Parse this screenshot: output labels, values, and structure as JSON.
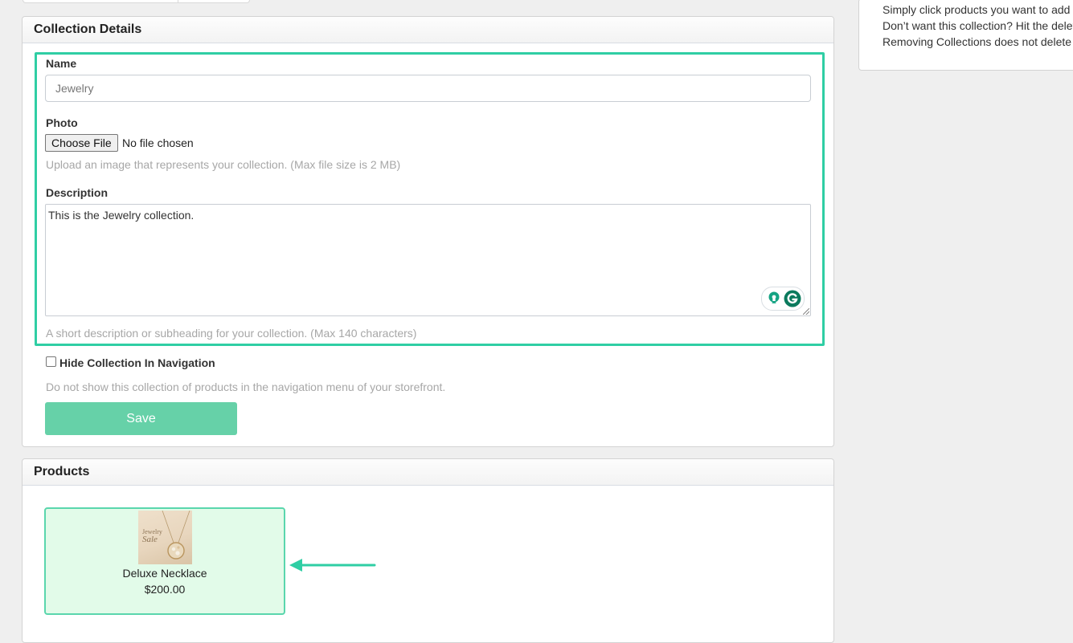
{
  "help_panel": {
    "lines": [
      "Simply click products you want to add",
      "Don’t want this collection? Hit the delete",
      "Removing Collections does not delete"
    ]
  },
  "collection_details": {
    "title": "Collection Details",
    "name_label": "Name",
    "name_value": "Jewelry",
    "photo_label": "Photo",
    "choose_file_label": "Choose File",
    "file_status": "No file chosen",
    "photo_help": "Upload an image that represents your collection. (Max file size is 2 MB)",
    "description_label": "Description",
    "description_value": "This is the Jewelry collection.",
    "description_help": "A short description or subheading for your collection. (Max 140 characters)",
    "hide_label": "Hide Collection In Navigation",
    "hide_checked": false,
    "hide_help": "Do not show this collection of products in the navigation menu of your storefront.",
    "save_label": "Save"
  },
  "products": {
    "title": "Products",
    "items": [
      {
        "name": "Deluxe Necklace",
        "price": "$200.00",
        "thumb_text_1": "Jewelry",
        "thumb_text_2": "Sale"
      }
    ]
  },
  "colors": {
    "accent": "#2fcea4",
    "save_button": "#66d1a8",
    "card_bg": "#e2fbe9"
  },
  "icons": [
    "bulb-icon",
    "grammarly-icon",
    "arrow-left-icon"
  ]
}
